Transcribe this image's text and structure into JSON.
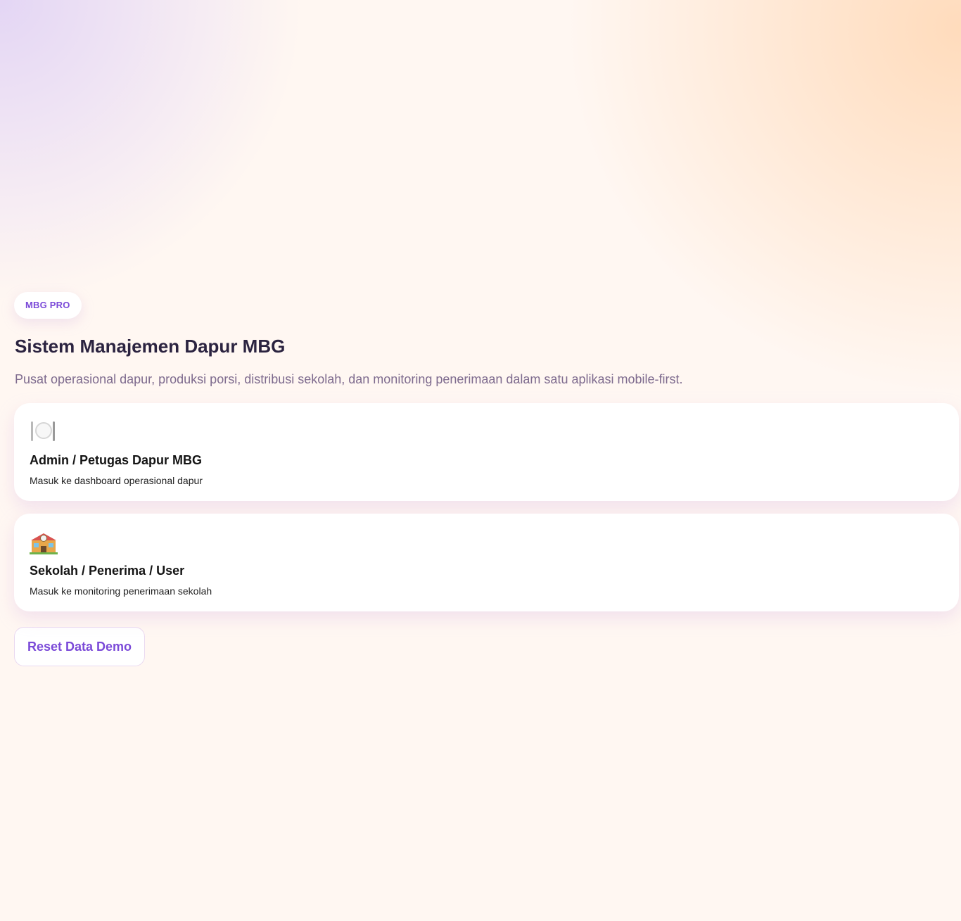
{
  "badge": "MBG PRO",
  "title": "Sistem Manajemen Dapur MBG",
  "subtitle": "Pusat operasional dapur, produksi porsi, distribusi sekolah, dan monitoring penerimaan dalam satu aplikasi mobile-first.",
  "roles": [
    {
      "icon": "plate-cutlery-icon",
      "title": "Admin / Petugas Dapur MBG",
      "description": "Masuk ke dashboard operasional dapur"
    },
    {
      "icon": "school-icon",
      "title": "Sekolah / Penerima / User",
      "description": "Masuk ke monitoring penerimaan sekolah"
    }
  ],
  "reset_label": "Reset Data Demo",
  "colors": {
    "accent": "#7b4ad8",
    "title": "#2b2340",
    "subtitle": "#7e6b8e",
    "background": "#fff7f2"
  }
}
